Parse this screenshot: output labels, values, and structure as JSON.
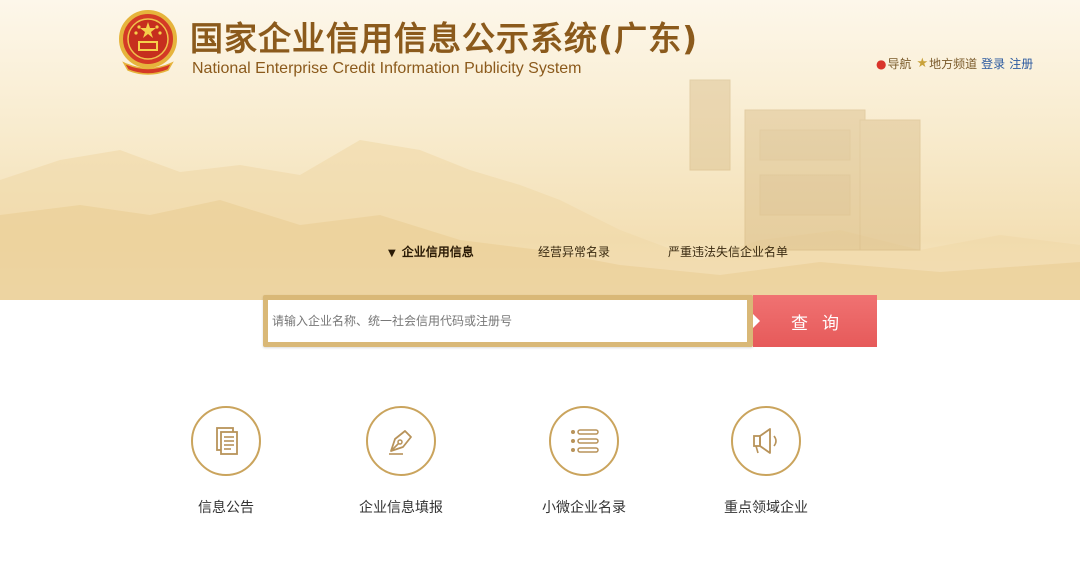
{
  "header": {
    "title_cn": "国家企业信用信息公示系统(广东)",
    "title_en": "National Enterprise Credit Information Publicity System"
  },
  "topnav": {
    "nav_label": "导航",
    "local_label": "地方频道",
    "login_label": "登录",
    "register_label": "注册"
  },
  "tabs": [
    {
      "label": "企业信用信息",
      "active": true
    },
    {
      "label": "经营异常名录",
      "active": false
    },
    {
      "label": "严重违法失信企业名单",
      "active": false
    }
  ],
  "search": {
    "placeholder": "请输入企业名称、统一社会信用代码或注册号",
    "value": "",
    "button_label": "查询"
  },
  "features": [
    {
      "label": "信息公告",
      "icon": "document-icon"
    },
    {
      "label": "企业信息填报",
      "icon": "pen-nib-icon"
    },
    {
      "label": "小微企业名录",
      "icon": "list-icon"
    },
    {
      "label": "重点领域企业",
      "icon": "speaker-icon"
    }
  ],
  "colors": {
    "brand_brown": "#8b5a1c",
    "gold_border": "#caa45d",
    "search_button": "#e65a5a",
    "link_blue": "#2c5aa0"
  }
}
